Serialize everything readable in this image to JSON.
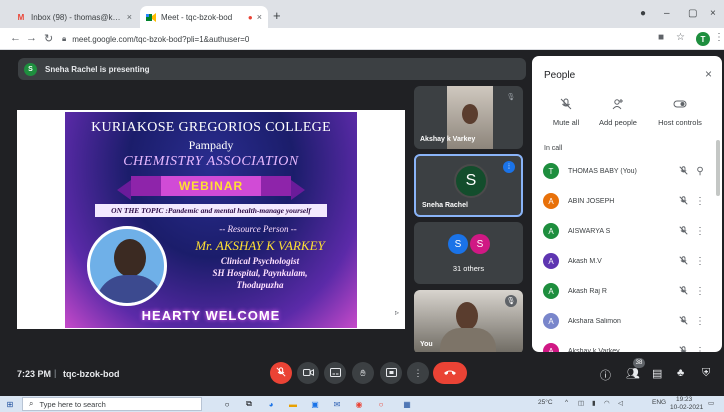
{
  "browser": {
    "tabs": [
      {
        "title": "Inbox (98) - thomas@kgcollege.a",
        "icon": "gmail-icon",
        "close": "×"
      },
      {
        "title": "Meet - tqc-bzok-bod",
        "icon": "meet-icon",
        "close": "×",
        "recording_dot": "●"
      }
    ],
    "new_tab": "+",
    "window_controls": {
      "minimize": "–",
      "restore": "▢",
      "close": "×"
    },
    "url": "meet.google.com/tqc-bzok-bod?pli=1&authuser=0",
    "profile_initial": "T"
  },
  "meet": {
    "presenting_initial": "S",
    "presenting_text": "Sneha Rachel is presenting",
    "slide": {
      "college": "KURIAKOSE GREGORIOS COLLEGE",
      "place": "Pampady",
      "association": "CHEMISTRY ASSOCIATION",
      "webinar": "WEBINAR",
      "topic": "ON THE TOPIC :Pandemic and mental health-manage yourself",
      "resource_label": "-- Resource Person --",
      "speaker": "Mr. AKSHAY K VARKEY",
      "role": "Clinical Psychologist",
      "hospital": "SH Hospital, Paynkulam,",
      "town": "Thodupuzha",
      "welcome": "HEARTY WELCOME"
    },
    "tiles": [
      {
        "name": "Akshay k Varkey"
      },
      {
        "name": "Sneha Rachel",
        "initial": "S"
      },
      {
        "initials": [
          "S",
          "S"
        ],
        "label": "31 others"
      },
      {
        "name": "You"
      }
    ],
    "colors": {
      "accent_blue": "#8ab4f8",
      "green": "#1e8e3e",
      "red": "#ea4335",
      "orange": "#e8710a",
      "pink": "#d01884",
      "purple": "#5e35b1"
    }
  },
  "people_panel": {
    "title": "People",
    "close": "×",
    "actions": [
      {
        "label": "Mute all",
        "icon": "mic-off-icon"
      },
      {
        "label": "Add people",
        "icon": "add-person-icon"
      },
      {
        "label": "Host controls",
        "icon": "toggle-icon"
      }
    ],
    "section": "In call",
    "participants": [
      {
        "initial": "T",
        "name": "THOMAS BABY (You)",
        "color": "#1e8e3e",
        "trailing": "pin"
      },
      {
        "initial": "A",
        "name": "ABIN JOSEPH",
        "color": "#e8710a",
        "trailing": "more"
      },
      {
        "initial": "A",
        "name": "AISWARYA S",
        "color": "#1e8e3e",
        "trailing": "more"
      },
      {
        "initial": "A",
        "name": "Akash M.V",
        "color": "#5e35b1",
        "trailing": "more"
      },
      {
        "initial": "A",
        "name": "Akash Raj R",
        "color": "#1e8e3e",
        "trailing": "more"
      },
      {
        "initial": "A",
        "name": "Akshara Salimon",
        "color": "#7986cb",
        "trailing": "more"
      },
      {
        "initial": "A",
        "name": "Akshay k Varkey",
        "color": "#d01884",
        "trailing": "more"
      }
    ]
  },
  "bottom_bar": {
    "time": "7:23 PM",
    "separator": "|",
    "meeting_code": "tqc-bzok-bod",
    "people_count": "38"
  },
  "taskbar": {
    "search_placeholder": "Type here to search",
    "weather": "25°C",
    "language": "ENG",
    "time": "19:23",
    "date": "10-02-2021"
  }
}
